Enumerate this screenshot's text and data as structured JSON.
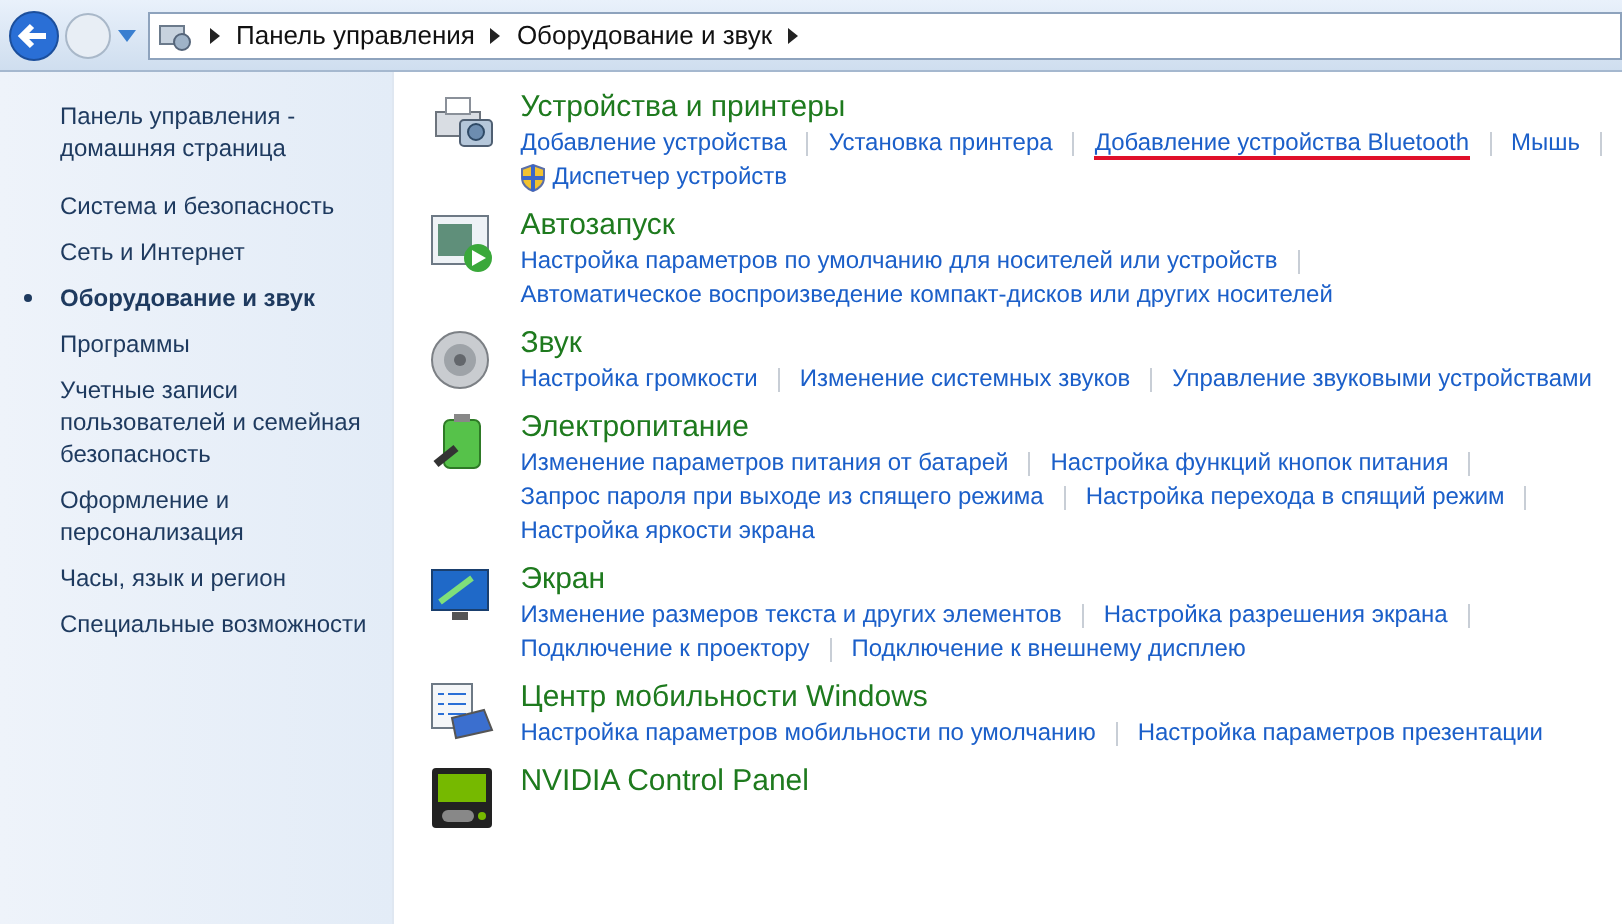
{
  "address_bar": {
    "breadcrumbs": [
      "Панель управления",
      "Оборудование и звук"
    ]
  },
  "sidebar": {
    "items": [
      {
        "label": "Панель управления - домашняя страница",
        "selected": false
      },
      {
        "label": "Система и безопасность",
        "selected": false
      },
      {
        "label": "Сеть и Интернет",
        "selected": false
      },
      {
        "label": "Оборудование и звук",
        "selected": true
      },
      {
        "label": "Программы",
        "selected": false
      },
      {
        "label": "Учетные записи пользователей и семейная безопасность",
        "selected": false
      },
      {
        "label": "Оформление и персонализация",
        "selected": false
      },
      {
        "label": "Часы, язык и регион",
        "selected": false
      },
      {
        "label": "Специальные возможности",
        "selected": false
      }
    ]
  },
  "sections": [
    {
      "kind": "devices",
      "title": "Устройства и принтеры",
      "lines": [
        [
          {
            "text": "Добавление устройства",
            "kind": "plain"
          },
          {
            "text": "Установка принтера",
            "kind": "plain"
          },
          {
            "text": "Добавление устройства Bluetooth",
            "kind": "highlighted"
          },
          {
            "text": "Мышь",
            "kind": "plain"
          }
        ],
        [
          {
            "text": "Диспетчер устройств",
            "kind": "admin"
          }
        ]
      ]
    },
    {
      "kind": "autoplay",
      "title": "Автозапуск",
      "lines": [
        [
          {
            "text": "Настройка параметров по умолчанию для носителей или устройств",
            "kind": "plain"
          }
        ],
        [
          {
            "text": "Автоматическое воспроизведение компакт-дисков или других носителей",
            "kind": "plain"
          }
        ]
      ]
    },
    {
      "kind": "sound",
      "title": "Звук",
      "lines": [
        [
          {
            "text": "Настройка громкости",
            "kind": "plain"
          },
          {
            "text": "Изменение системных звуков",
            "kind": "plain"
          },
          {
            "text": "Управление звуковыми устройствами",
            "kind": "plain"
          }
        ]
      ]
    },
    {
      "kind": "power",
      "title": "Электропитание",
      "lines": [
        [
          {
            "text": "Изменение параметров питания от батарей",
            "kind": "plain"
          },
          {
            "text": "Настройка функций кнопок питания",
            "kind": "plain"
          }
        ],
        [
          {
            "text": "Запрос пароля при выходе из спящего режима",
            "kind": "plain"
          },
          {
            "text": "Настройка перехода в спящий режим",
            "kind": "plain"
          }
        ],
        [
          {
            "text": "Настройка яркости экрана",
            "kind": "plain"
          }
        ]
      ]
    },
    {
      "kind": "display",
      "title": "Экран",
      "lines": [
        [
          {
            "text": "Изменение размеров текста и других элементов",
            "kind": "plain"
          },
          {
            "text": "Настройка разрешения экрана",
            "kind": "plain"
          }
        ],
        [
          {
            "text": "Подключение к проектору",
            "kind": "plain"
          },
          {
            "text": "Подключение к внешнему дисплею",
            "kind": "plain"
          }
        ]
      ]
    },
    {
      "kind": "mobility",
      "title": "Центр мобильности Windows",
      "lines": [
        [
          {
            "text": "Настройка параметров мобильности по умолчанию",
            "kind": "plain"
          },
          {
            "text": "Настройка параметров презентации",
            "kind": "plain"
          }
        ]
      ]
    },
    {
      "kind": "nvidia",
      "title": "NVIDIA Control Panel"
    }
  ]
}
